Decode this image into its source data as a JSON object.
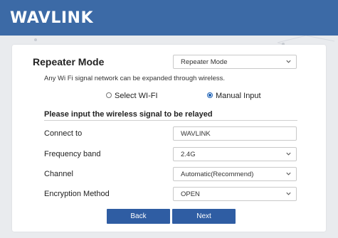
{
  "brand": {
    "logo_text": "WAVLINK"
  },
  "page": {
    "title": "Repeater Mode",
    "mode_select_value": "Repeater Mode",
    "description": "Any Wi Fi signal network can be expanded through wireless.",
    "radio_options": [
      {
        "label": "Select WI-FI",
        "checked": false
      },
      {
        "label": "Manual Input",
        "checked": true
      }
    ],
    "section_title": "Please input the wireless signal to be relayed",
    "fields": {
      "connect_to": {
        "label": "Connect to",
        "value": "WAVLINK"
      },
      "frequency_band": {
        "label": "Frequency band",
        "value": "2.4G"
      },
      "channel": {
        "label": "Channel",
        "value": "Automatic(Recommend)"
      },
      "encryption": {
        "label": "Encryption Method",
        "value": "OPEN"
      }
    },
    "buttons": {
      "back": "Back",
      "next": "Next"
    }
  },
  "colors": {
    "header": "#3c6aa6",
    "button": "#2f5da3",
    "radio_checked": "#1a5fb4"
  }
}
